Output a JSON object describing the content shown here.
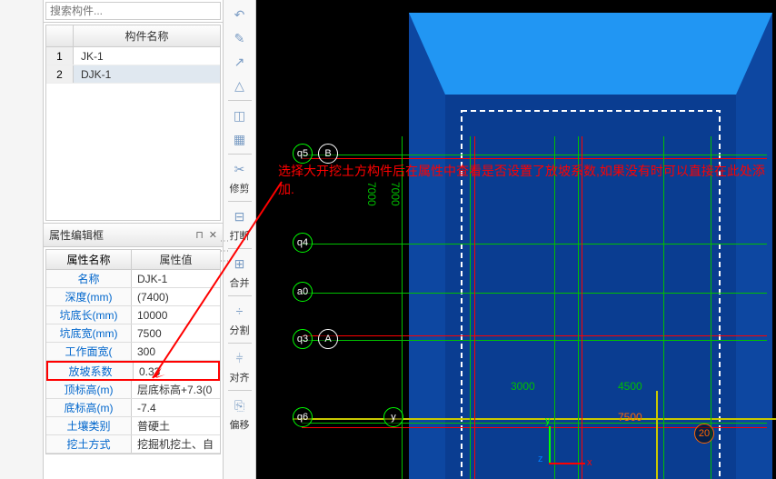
{
  "search": {
    "placeholder": "搜索构件..."
  },
  "component_list": {
    "header": "构件名称",
    "rows": [
      {
        "num": "1",
        "name": "JK-1"
      },
      {
        "num": "2",
        "name": "DJK-1"
      }
    ]
  },
  "prop_editor": {
    "title": "属性编辑框",
    "header_name": "属性名称",
    "header_value": "属性值",
    "rows": [
      {
        "name": "名称",
        "value": "DJK-1"
      },
      {
        "name": "深度(mm)",
        "value": "(7400)"
      },
      {
        "name": "坑底长(mm)",
        "value": "10000"
      },
      {
        "name": "坑底宽(mm)",
        "value": "7500"
      },
      {
        "name": "工作面宽(",
        "value": "300"
      },
      {
        "name": "放坡系数",
        "value": "0.33",
        "highlighted": true
      },
      {
        "name": "顶标高(m)",
        "value": "层底标高+7.3(0"
      },
      {
        "name": "底标高(m)",
        "value": "-7.4"
      },
      {
        "name": "土壤类别",
        "value": "普硬土"
      },
      {
        "name": "挖土方式",
        "value": "挖掘机挖土、自"
      }
    ]
  },
  "toolbar": {
    "items": [
      "↶",
      "✎",
      "↗",
      "△",
      "◫",
      "▦"
    ],
    "labels": [
      "修剪",
      "打断",
      "合并",
      "分割",
      "对齐",
      "偏移"
    ]
  },
  "canvas": {
    "axis_labels": {
      "q5": "q5",
      "B": "B",
      "q4": "q4",
      "a0": "a0",
      "q3": "q3",
      "A": "A",
      "q6": "q6",
      "y": "y",
      "twenty": "20"
    },
    "dims": {
      "d7000": "7000",
      "d7000b": "7000",
      "d3000": "3000",
      "d4500": "4500",
      "d7500": "7500"
    }
  },
  "annotation_text": "选择大开挖土方构件后在属性中查看是否设置了放坡系数,如果没有时可以直接在此处添加."
}
